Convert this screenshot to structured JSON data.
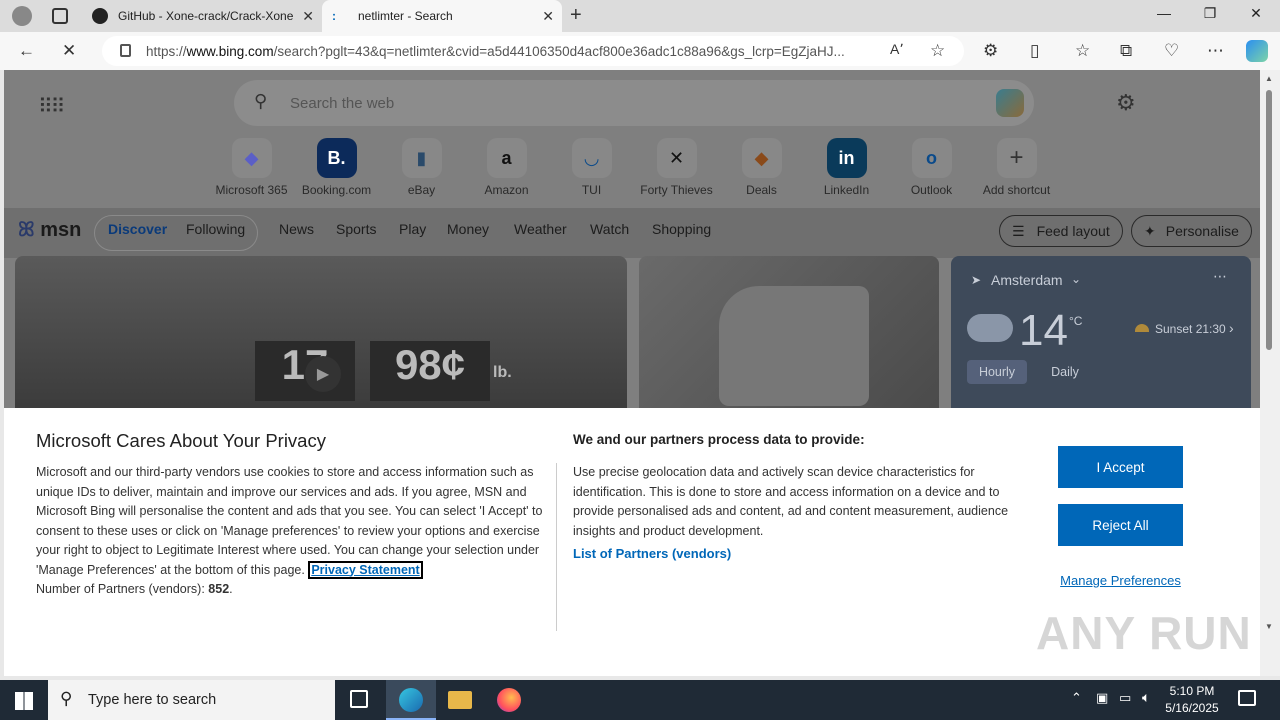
{
  "browser": {
    "tabs": [
      {
        "title": "GitHub - Xone-crack/Crack-Xone"
      },
      {
        "title": "netlimter - Search"
      }
    ],
    "url": {
      "prefix": "https://",
      "host": "www.bing.com",
      "path": "/search?pglt=43&q=netlimter&cvid=a5d44106350d4acf800e36adc1c88a96&gs_lcrp=EgZjaHJ..."
    }
  },
  "page": {
    "search_placeholder": "Search the web",
    "shortcuts": [
      {
        "label": "Microsoft 365",
        "icon": "microsoft365-icon",
        "glyph": "◆"
      },
      {
        "label": "Booking.com",
        "icon": "booking-icon",
        "glyph": "B."
      },
      {
        "label": "eBay",
        "icon": "ebay-icon",
        "glyph": "▮"
      },
      {
        "label": "Amazon",
        "icon": "amazon-icon",
        "glyph": "a"
      },
      {
        "label": "TUI",
        "icon": "tui-icon",
        "glyph": "◡"
      },
      {
        "label": "Forty Thieves",
        "icon": "forty-thieves-icon",
        "glyph": "✕"
      },
      {
        "label": "Deals",
        "icon": "deals-icon",
        "glyph": "◆"
      },
      {
        "label": "LinkedIn",
        "icon": "linkedin-icon",
        "glyph": "in"
      },
      {
        "label": "Outlook",
        "icon": "outlook-icon",
        "glyph": "o"
      },
      {
        "label": "Add shortcut",
        "icon": "plus-icon",
        "glyph": "+"
      }
    ],
    "msn": {
      "logo": "msn",
      "discover": "Discover",
      "following": "Following",
      "nav": [
        "News",
        "Sports",
        "Play",
        "Money",
        "Weather",
        "Watch",
        "Shopping"
      ],
      "feed_layout": "Feed layout",
      "personalise": "Personalise"
    },
    "hero": {
      "price1": "17",
      "price2": "98¢",
      "unit": "lb."
    },
    "weather": {
      "city": "Amsterdam",
      "temp": "14",
      "unit": "°C",
      "sunset": "Sunset 21:30",
      "tabs": [
        "Hourly",
        "Daily"
      ]
    }
  },
  "consent": {
    "title": "Microsoft Cares About Your Privacy",
    "left_text": "Microsoft and our third-party vendors use cookies to store and access information such as unique IDs to deliver, maintain and improve our services and ads. If you agree, MSN and Microsoft Bing will personalise the content and ads that you see. You can select 'I Accept' to consent to these uses or click on 'Manage preferences' to review your options and exercise your right to object to Legitimate Interest where used. You can change your selection under 'Manage Preferences' at the bottom of this page.",
    "privacy_link": "Privacy Statement",
    "partners_count_label": "Number of Partners (vendors):",
    "partners_count": "852",
    "right_title": "We and our partners process data to provide:",
    "right_text": "Use precise geolocation data and actively scan device characteristics for identification. This is done to store and access information on a device and to provide personalised ads and content, ad and content measurement, audience insights and product development.",
    "partners_link": "List of Partners (vendors)",
    "accept": "I Accept",
    "reject": "Reject All",
    "manage": "Manage Preferences"
  },
  "taskbar": {
    "search_placeholder": "Type here to search",
    "time": "5:10 PM",
    "date": "5/16/2025"
  },
  "watermark": "ANY RUN"
}
